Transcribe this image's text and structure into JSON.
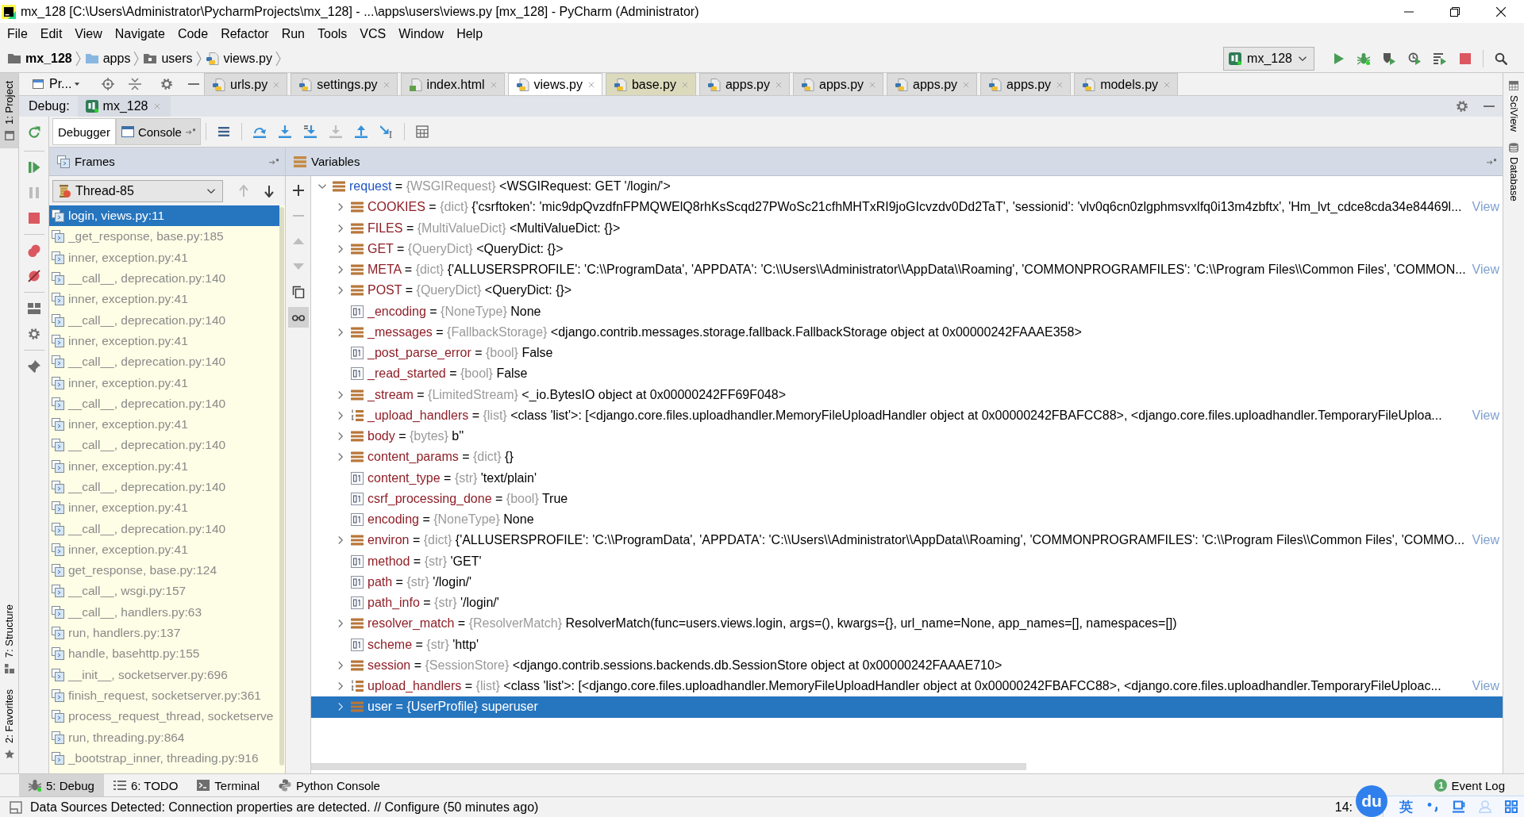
{
  "window": {
    "title": "mx_128 [C:\\Users\\Administrator\\PycharmProjects\\mx_128] - ...\\apps\\users\\views.py [mx_128] - PyCharm (Administrator)"
  },
  "menu": [
    "File",
    "Edit",
    "View",
    "Navigate",
    "Code",
    "Refactor",
    "Run",
    "Tools",
    "VCS",
    "Window",
    "Help"
  ],
  "breadcrumbs": [
    {
      "label": "mx_128",
      "kind": "project"
    },
    {
      "label": "apps",
      "kind": "folder"
    },
    {
      "label": "users",
      "kind": "package"
    },
    {
      "label": "views.py",
      "kind": "python"
    }
  ],
  "run_config": {
    "label": "mx_128"
  },
  "left_stripe": {
    "top": [
      {
        "label": "1: Project",
        "kind": "project",
        "selected": true
      }
    ],
    "bottom": [
      {
        "label": "7: Structure",
        "kind": "structure",
        "selected": false
      },
      {
        "label": "2: Favorites",
        "kind": "favorites",
        "selected": false
      }
    ]
  },
  "project_view": {
    "label": "Pr..."
  },
  "editor_tabs": [
    {
      "label": "urls.py",
      "kind": "python",
      "selected": false,
      "library": false
    },
    {
      "label": "settings.py",
      "kind": "python",
      "selected": false,
      "library": false
    },
    {
      "label": "index.html",
      "kind": "html",
      "selected": false,
      "library": false
    },
    {
      "label": "views.py",
      "kind": "python",
      "selected": true,
      "library": false
    },
    {
      "label": "base.py",
      "kind": "python",
      "selected": false,
      "library": true
    },
    {
      "label": "apps.py",
      "kind": "python",
      "selected": false,
      "library": false
    },
    {
      "label": "apps.py",
      "kind": "python",
      "selected": false,
      "library": false
    },
    {
      "label": "apps.py",
      "kind": "python",
      "selected": false,
      "library": false
    },
    {
      "label": "apps.py",
      "kind": "python",
      "selected": false,
      "library": false
    },
    {
      "label": "models.py",
      "kind": "python",
      "selected": false,
      "library": false
    }
  ],
  "debug": {
    "label": "Debug:",
    "session": "mx_128"
  },
  "side_toolbar": [
    {
      "kind": "rerun",
      "disabled": false
    },
    {
      "kind": "resume",
      "disabled": false
    },
    {
      "kind": "pause",
      "disabled": true
    },
    {
      "kind": "stop",
      "disabled": false
    },
    {
      "kind": "breakpoints",
      "disabled": false
    },
    {
      "kind": "mute-breakpoints",
      "disabled": false
    },
    {
      "kind": "layout",
      "disabled": false
    },
    {
      "kind": "settings",
      "disabled": false
    },
    {
      "kind": "pin",
      "disabled": false
    }
  ],
  "debugger_tabs": [
    {
      "label": "Debugger",
      "kind": "debugger",
      "selected": true
    },
    {
      "label": "Console",
      "kind": "console",
      "selected": false
    }
  ],
  "step_toolbar": [
    {
      "kind": "show-execution-point",
      "disabled": false
    },
    {
      "kind": "step-over",
      "disabled": false
    },
    {
      "kind": "step-into",
      "disabled": false
    },
    {
      "kind": "step-into-my-code",
      "disabled": false
    },
    {
      "kind": "force-step-into",
      "disabled": true
    },
    {
      "kind": "step-out",
      "disabled": false
    },
    {
      "kind": "run-to-cursor",
      "disabled": false
    },
    {
      "kind": "evaluate",
      "disabled": false
    }
  ],
  "frames": {
    "title": "Frames",
    "thread": "Thread-85",
    "thread_nav": [
      {
        "kind": "up",
        "disabled": true
      },
      {
        "kind": "down",
        "disabled": false
      }
    ],
    "items": [
      {
        "label": "login, views.py:11",
        "selected": true
      },
      {
        "label": "_get_response, base.py:185",
        "selected": false
      },
      {
        "label": "inner, exception.py:41",
        "selected": false
      },
      {
        "label": "__call__, deprecation.py:140",
        "selected": false
      },
      {
        "label": "inner, exception.py:41",
        "selected": false
      },
      {
        "label": "__call__, deprecation.py:140",
        "selected": false
      },
      {
        "label": "inner, exception.py:41",
        "selected": false
      },
      {
        "label": "__call__, deprecation.py:140",
        "selected": false
      },
      {
        "label": "inner, exception.py:41",
        "selected": false
      },
      {
        "label": "__call__, deprecation.py:140",
        "selected": false
      },
      {
        "label": "inner, exception.py:41",
        "selected": false
      },
      {
        "label": "__call__, deprecation.py:140",
        "selected": false
      },
      {
        "label": "inner, exception.py:41",
        "selected": false
      },
      {
        "label": "__call__, deprecation.py:140",
        "selected": false
      },
      {
        "label": "inner, exception.py:41",
        "selected": false
      },
      {
        "label": "__call__, deprecation.py:140",
        "selected": false
      },
      {
        "label": "inner, exception.py:41",
        "selected": false
      },
      {
        "label": "get_response, base.py:124",
        "selected": false
      },
      {
        "label": "__call__, wsgi.py:157",
        "selected": false
      },
      {
        "label": "__call__, handlers.py:63",
        "selected": false
      },
      {
        "label": "run, handlers.py:137",
        "selected": false
      },
      {
        "label": "handle, basehttp.py:155",
        "selected": false
      },
      {
        "label": "__init__, socketserver.py:696",
        "selected": false
      },
      {
        "label": "finish_request, socketserver.py:361",
        "selected": false
      },
      {
        "label": "process_request_thread, socketserve",
        "selected": false
      },
      {
        "label": "run, threading.py:864",
        "selected": false
      },
      {
        "label": "_bootstrap_inner, threading.py:916",
        "selected": false
      }
    ]
  },
  "variables": {
    "title": "Variables",
    "watch_toolbar": [
      {
        "kind": "add",
        "disabled": false,
        "on": false
      },
      {
        "kind": "remove",
        "disabled": true,
        "on": false
      },
      {
        "kind": "up",
        "disabled": true,
        "on": false
      },
      {
        "kind": "down",
        "disabled": true,
        "on": false
      },
      {
        "kind": "copy",
        "disabled": false,
        "on": false
      },
      {
        "kind": "inline-watches",
        "disabled": false,
        "on": true
      }
    ],
    "items": [
      {
        "name": "request",
        "operator": "=",
        "type": "{WSGIRequest}",
        "value": "<WSGIRequest: GET '/login/'>",
        "kind": "object",
        "expanded": true,
        "selected": false,
        "changed": true,
        "children": [
          {
            "name": "COOKIES",
            "operator": "=",
            "type": "{dict}",
            "value": "{'csrftoken': 'mic9dpQvzdfnFPMQWElQ8rhKsScqd27PWoSc21cfhMHTxRI9joGIcvzdv0Dd2TaT', 'sessionid': 'vlv0q6cn0zlgphmsvxlfq0i13m4zbftx', 'Hm_lvt_cdce8cda34e84469l...",
            "link": "View",
            "kind": "object",
            "expanded": false,
            "selected": false,
            "changed": false
          },
          {
            "name": "FILES",
            "operator": "=",
            "type": "{MultiValueDict}",
            "value": "<MultiValueDict: {}>",
            "kind": "object",
            "expanded": false,
            "selected": false,
            "changed": false
          },
          {
            "name": "GET",
            "operator": "=",
            "type": "{QueryDict}",
            "value": "<QueryDict: {}>",
            "kind": "object",
            "expanded": false,
            "selected": false,
            "changed": false
          },
          {
            "name": "META",
            "operator": "=",
            "type": "{dict}",
            "value": "{'ALLUSERSPROFILE': 'C:\\\\ProgramData', 'APPDATA': 'C:\\\\Users\\\\Administrator\\\\AppData\\\\Roaming', 'COMMONPROGRAMFILES': 'C:\\\\Program Files\\\\Common Files', 'COMMON...",
            "link": "View",
            "kind": "object",
            "expanded": false,
            "selected": false,
            "changed": false
          },
          {
            "name": "POST",
            "operator": "=",
            "type": "{QueryDict}",
            "value": "<QueryDict: {}>",
            "kind": "object",
            "expanded": false,
            "selected": false,
            "changed": false
          },
          {
            "name": "_encoding",
            "operator": "=",
            "type": "{NoneType}",
            "value": "None",
            "kind": "primitive",
            "selected": false,
            "changed": false
          },
          {
            "name": "_messages",
            "operator": "=",
            "type": "{FallbackStorage}",
            "value": "<django.contrib.messages.storage.fallback.FallbackStorage object at 0x00000242FAAAE358>",
            "kind": "object",
            "expanded": false,
            "selected": false,
            "changed": false
          },
          {
            "name": "_post_parse_error",
            "operator": "=",
            "type": "{bool}",
            "value": "False",
            "kind": "primitive",
            "selected": false,
            "changed": false
          },
          {
            "name": "_read_started",
            "operator": "=",
            "type": "{bool}",
            "value": "False",
            "kind": "primitive",
            "selected": false,
            "changed": false
          },
          {
            "name": "_stream",
            "operator": "=",
            "type": "{LimitedStream}",
            "value": "<_io.BytesIO object at 0x00000242FF69F048>",
            "kind": "object",
            "expanded": false,
            "selected": false,
            "changed": false
          },
          {
            "name": "_upload_handlers",
            "operator": "=",
            "type": "{list}",
            "value": "<class 'list'>: [<django.core.files.uploadhandler.MemoryFileUploadHandler object at 0x00000242FBAFCC88>, <django.core.files.uploadhandler.TemporaryFileUploa...",
            "link": "View",
            "kind": "list",
            "expanded": false,
            "selected": false,
            "changed": false
          },
          {
            "name": "body",
            "operator": "=",
            "type": "{bytes}",
            "value": "b''",
            "kind": "object",
            "expanded": false,
            "selected": false,
            "changed": false
          },
          {
            "name": "content_params",
            "operator": "=",
            "type": "{dict}",
            "value": "{}",
            "kind": "object",
            "expanded": false,
            "selected": false,
            "changed": false
          },
          {
            "name": "content_type",
            "operator": "=",
            "type": "{str}",
            "value": "'text/plain'",
            "kind": "primitive",
            "selected": false,
            "changed": false
          },
          {
            "name": "csrf_processing_done",
            "operator": "=",
            "type": "{bool}",
            "value": "True",
            "kind": "primitive",
            "selected": false,
            "changed": false
          },
          {
            "name": "encoding",
            "operator": "=",
            "type": "{NoneType}",
            "value": "None",
            "kind": "primitive",
            "selected": false,
            "changed": false
          },
          {
            "name": "environ",
            "operator": "=",
            "type": "{dict}",
            "value": "{'ALLUSERSPROFILE': 'C:\\\\ProgramData', 'APPDATA': 'C:\\\\Users\\\\Administrator\\\\AppData\\\\Roaming', 'COMMONPROGRAMFILES': 'C:\\\\Program Files\\\\Common Files', 'COMMO...",
            "link": "View",
            "kind": "object",
            "expanded": false,
            "selected": false,
            "changed": false
          },
          {
            "name": "method",
            "operator": "=",
            "type": "{str}",
            "value": "'GET'",
            "kind": "primitive",
            "selected": false,
            "changed": false
          },
          {
            "name": "path",
            "operator": "=",
            "type": "{str}",
            "value": "'/login/'",
            "kind": "primitive",
            "selected": false,
            "changed": false
          },
          {
            "name": "path_info",
            "operator": "=",
            "type": "{str}",
            "value": "'/login/'",
            "kind": "primitive",
            "selected": false,
            "changed": false
          },
          {
            "name": "resolver_match",
            "operator": "=",
            "type": "{ResolverMatch}",
            "value": "ResolverMatch(func=users.views.login, args=(), kwargs={}, url_name=None, app_names=[], namespaces=[])",
            "kind": "object",
            "expanded": false,
            "selected": false,
            "changed": false
          },
          {
            "name": "scheme",
            "operator": "=",
            "type": "{str}",
            "value": "'http'",
            "kind": "primitive",
            "selected": false,
            "changed": false
          },
          {
            "name": "session",
            "operator": "=",
            "type": "{SessionStore}",
            "value": "<django.contrib.sessions.backends.db.SessionStore object at 0x00000242FAAAE710>",
            "kind": "object",
            "expanded": false,
            "selected": false,
            "changed": false
          },
          {
            "name": "upload_handlers",
            "operator": "=",
            "type": "{list}",
            "value": "<class 'list'>: [<django.core.files.uploadhandler.MemoryFileUploadHandler object at 0x00000242FBAFCC88>, <django.core.files.uploadhandler.TemporaryFileUploac...",
            "link": "View",
            "kind": "list",
            "expanded": false,
            "selected": false,
            "changed": false
          },
          {
            "name": "user",
            "operator": "=",
            "type": "{UserProfile}",
            "value": "superuser",
            "kind": "object",
            "expanded": false,
            "selected": true,
            "changed": false
          }
        ]
      }
    ]
  },
  "right_stripe": [
    {
      "label": "SciView",
      "kind": "sciview"
    },
    {
      "label": "Database",
      "kind": "database"
    }
  ],
  "bottom_tabs": [
    {
      "label": "5: Debug",
      "kind": "debug",
      "selected": true
    },
    {
      "label": "6: TODO",
      "kind": "todo",
      "selected": false
    },
    {
      "label": "Terminal",
      "kind": "terminal",
      "selected": false
    },
    {
      "label": "Python Console",
      "kind": "python-console",
      "selected": false
    }
  ],
  "event_log": {
    "label": "Event Log",
    "count": "1"
  },
  "status_bar": {
    "message": "Data Sources Detected: Connection properties are detected. // Configure (50 minutes ago)",
    "caret_position": "14:"
  },
  "ime_toolbar": {
    "logo": "du",
    "mode": "英"
  }
}
